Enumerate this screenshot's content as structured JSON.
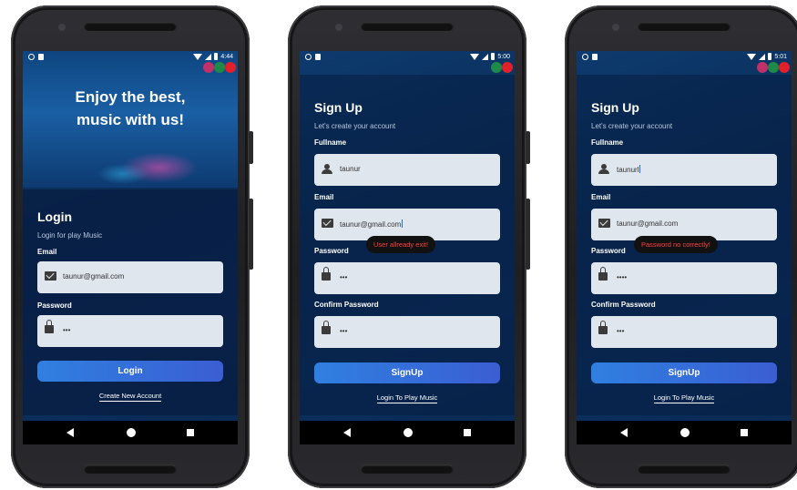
{
  "screens": [
    {
      "status_time": "4:44",
      "hero_line1": "Enjoy the best,",
      "hero_line2": "music with us!",
      "title": "Login",
      "subtitle": "Login for play Music",
      "email_label": "Email",
      "email_value": "taunur@gmail.com",
      "password_label": "Password",
      "password_value": "•••",
      "button_label": "Login",
      "link_label": "Create New Account"
    },
    {
      "status_time": "5:00",
      "title": "Sign Up",
      "subtitle": "Let's create your account",
      "fullname_label": "Fullname",
      "fullname_value": "taunur",
      "email_label": "Email",
      "email_value": "taunur@gmail.com",
      "password_label": "Password",
      "password_value": "•••",
      "confirm_label": "Confirm Password",
      "confirm_value": "•••",
      "toast": "User allready exit!",
      "button_label": "SignUp",
      "link_label": "Login To Play Music"
    },
    {
      "status_time": "5:01",
      "title": "Sign Up",
      "subtitle": "Let's create your account",
      "fullname_label": "Fullname",
      "fullname_value": "taunurl",
      "email_label": "Email",
      "email_value": "taunur@gmail.com",
      "password_label": "Password",
      "password_value": "••••",
      "confirm_label": "Confirm Password",
      "confirm_value": "•••",
      "toast": "Password no correctly!",
      "button_label": "SignUp",
      "link_label": "Login To Play Music"
    }
  ],
  "colors": {
    "accent_button": "#2f7fe0",
    "toast_text": "#ff4040",
    "background": "#0a2d57"
  }
}
